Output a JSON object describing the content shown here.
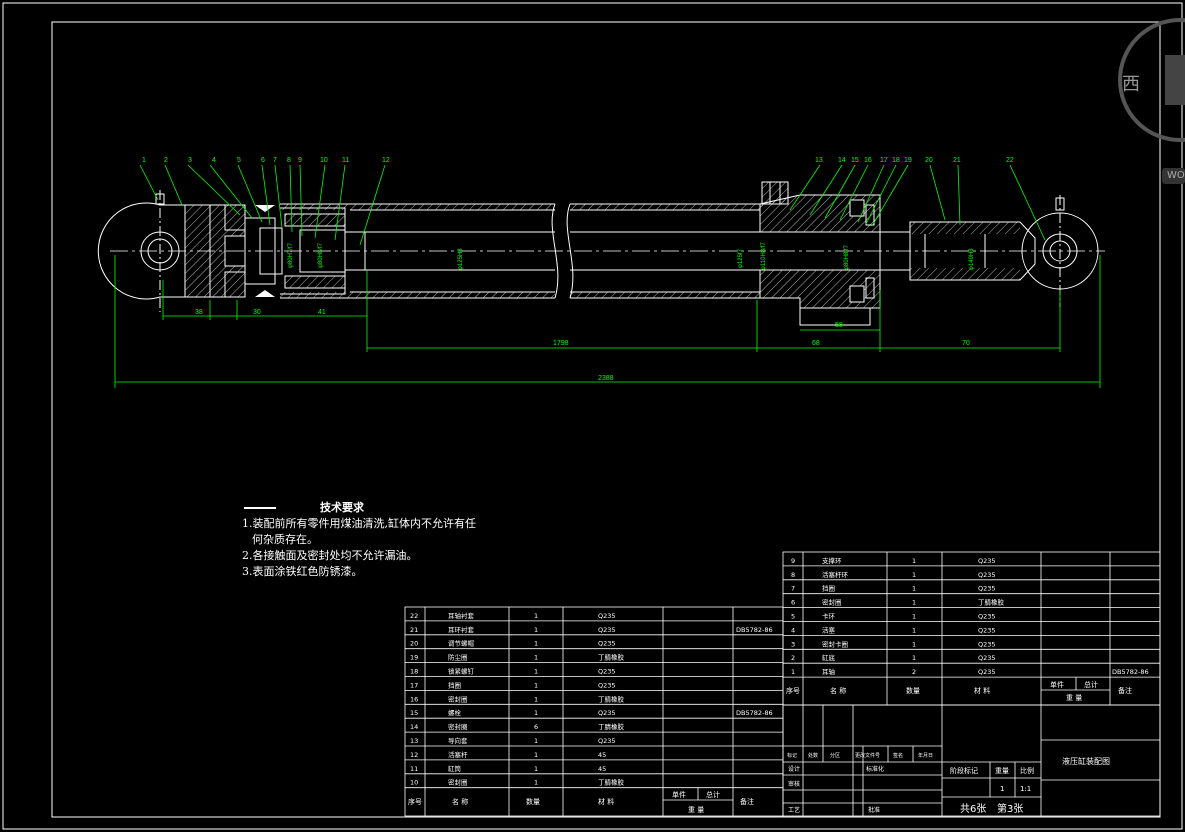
{
  "drawing": {
    "balloons": [
      "1",
      "2",
      "3",
      "4",
      "5",
      "6",
      "7",
      "8",
      "9",
      "10",
      "11",
      "12",
      "13",
      "14",
      "15",
      "16",
      "17",
      "18",
      "19",
      "20",
      "21",
      "22"
    ],
    "dimensions": {
      "d38": "38",
      "d30": "30",
      "d41": "41",
      "d1798": "1798",
      "d68": "68",
      "d70": "70",
      "d58": "58",
      "d2388": "2388",
      "phi_a": "φ80H7/f7",
      "phi_b": "φ80H8/f7",
      "phi_c": "φ125H8",
      "phi_d": "φ125f7",
      "phi_e": "φ110H8/f7",
      "phi_f": "φ80H8/f7",
      "phi_g": "φ140H8"
    }
  },
  "tech_requirements": {
    "title": "技术要求",
    "lines": [
      "1.装配前所有零件用煤油清洗,缸体内不允许有任",
      "何杂质存在。",
      "2.各接触面及密封处均不允许漏油。",
      "3.表面涂铁红色防锈漆。"
    ]
  },
  "bom_right": {
    "rows": [
      {
        "no": "9",
        "name": "支撑环",
        "qty": "1",
        "mat": "Q235",
        "std": ""
      },
      {
        "no": "8",
        "name": "活塞杆环",
        "qty": "1",
        "mat": "Q235",
        "std": ""
      },
      {
        "no": "7",
        "name": "挡圈",
        "qty": "1",
        "mat": "Q235",
        "std": ""
      },
      {
        "no": "6",
        "name": "密封圈",
        "qty": "1",
        "mat": "丁腈橡胶",
        "std": ""
      },
      {
        "no": "5",
        "name": "卡环",
        "qty": "1",
        "mat": "Q235",
        "std": ""
      },
      {
        "no": "4",
        "name": "活塞",
        "qty": "1",
        "mat": "Q235",
        "std": ""
      },
      {
        "no": "3",
        "name": "密封卡圈",
        "qty": "1",
        "mat": "Q235",
        "std": ""
      },
      {
        "no": "2",
        "name": "缸底",
        "qty": "1",
        "mat": "Q235",
        "std": ""
      },
      {
        "no": "1",
        "name": "耳轴",
        "qty": "2",
        "mat": "Q235",
        "std": "DB5782-86"
      }
    ],
    "header": {
      "no": "序号",
      "name": "名 称",
      "qty": "数量",
      "mat": "材 料",
      "single": "单件",
      "total": "总计",
      "weight": "重 量",
      "remark": "备注"
    }
  },
  "bom_left": {
    "rows": [
      {
        "no": "22",
        "name": "耳轴衬套",
        "qty": "1",
        "mat": "Q235",
        "std": ""
      },
      {
        "no": "21",
        "name": "耳环衬套",
        "qty": "1",
        "mat": "Q235",
        "std": "DB5782-86"
      },
      {
        "no": "20",
        "name": "调节螺帽",
        "qty": "1",
        "mat": "Q235",
        "std": ""
      },
      {
        "no": "19",
        "name": "防尘圈",
        "qty": "1",
        "mat": "丁腈橡胶",
        "std": ""
      },
      {
        "no": "18",
        "name": "锁紧螺钉",
        "qty": "1",
        "mat": "Q235",
        "std": ""
      },
      {
        "no": "17",
        "name": "挡圈",
        "qty": "1",
        "mat": "Q235",
        "std": ""
      },
      {
        "no": "16",
        "name": "密封圈",
        "qty": "1",
        "mat": "丁腈橡胶",
        "std": ""
      },
      {
        "no": "15",
        "name": "螺栓",
        "qty": "1",
        "mat": "Q235",
        "std": "DB5782-86"
      },
      {
        "no": "14",
        "name": "密封圈",
        "qty": "6",
        "mat": "丁腈橡胶",
        "std": ""
      },
      {
        "no": "13",
        "name": "导向套",
        "qty": "1",
        "mat": "Q235",
        "std": ""
      },
      {
        "no": "12",
        "name": "活塞杆",
        "qty": "1",
        "mat": "45",
        "std": ""
      },
      {
        "no": "11",
        "name": "缸筒",
        "qty": "1",
        "mat": "45",
        "std": ""
      },
      {
        "no": "10",
        "name": "密封圈",
        "qty": "1",
        "mat": "丁腈橡胶",
        "std": ""
      }
    ],
    "header": {
      "no": "序号",
      "name": "名 称",
      "qty": "数量",
      "mat": "材 料",
      "single": "单件",
      "total": "总计",
      "weight": "重 量",
      "remark": "备注"
    }
  },
  "title_block": {
    "drawing_title": "液压缸装配图",
    "stage_label": "阶段标记",
    "weight_label": "重量",
    "scale_label": "比例",
    "qty": "1",
    "scale": "1:1",
    "sheets": "共6张",
    "sheet_no": "第3张",
    "rev_headers": [
      "标记",
      "处数",
      "分区",
      "更改文件号",
      "签名",
      "年月日"
    ],
    "roles": [
      "设计",
      "审核",
      "工艺",
      "批准"
    ],
    "std_label": "标准化"
  },
  "watermark": {
    "char": "西",
    "text": "WO"
  },
  "colors": {
    "bg": "#000000",
    "line": "#ffffff",
    "green": "#00ff00",
    "yellow": "#ffff00",
    "red": "#ff0000",
    "blue": "#1e64ff"
  }
}
